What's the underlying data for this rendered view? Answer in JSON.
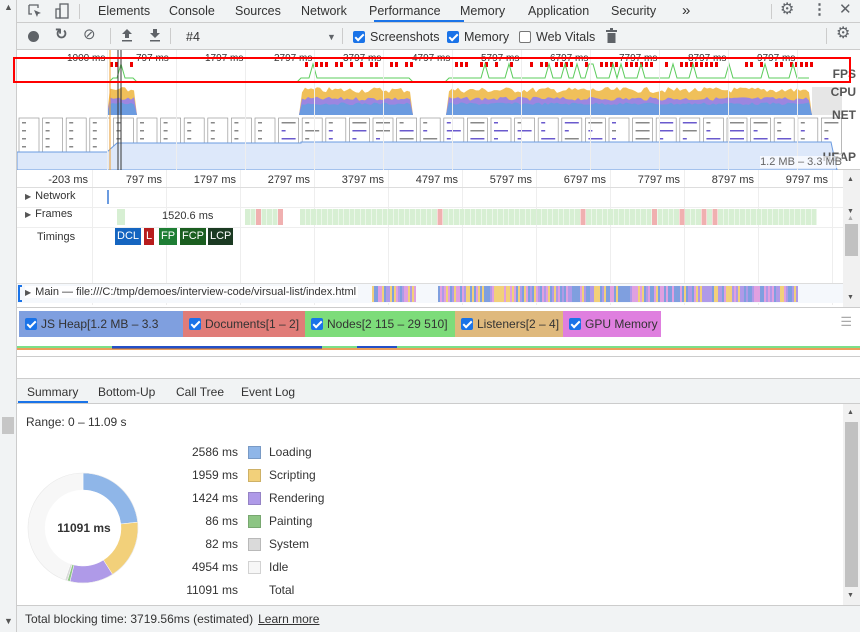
{
  "tabs": {
    "items": [
      {
        "label": "Elements"
      },
      {
        "label": "Console"
      },
      {
        "label": "Sources"
      },
      {
        "label": "Network"
      },
      {
        "label": "Performance",
        "active": true
      },
      {
        "label": "Memory"
      },
      {
        "label": "Application"
      },
      {
        "label": "Security"
      }
    ],
    "more": "»",
    "accent": "#1a73e8"
  },
  "toolbar": {
    "recording": "#4",
    "screenshots_label": "Screenshots",
    "screenshots_checked": true,
    "memory_label": "Memory",
    "memory_checked": true,
    "webvitals_label": "Web Vitals",
    "webvitals_checked": false
  },
  "overview": {
    "ticks": [
      "1000 ms",
      "797 ms",
      "1797 ms",
      "2797 ms",
      "3797 ms",
      "4797 ms",
      "5797 ms",
      "6797 ms",
      "7797 ms",
      "8797 ms",
      "9797 ms"
    ],
    "fps_label": "FPS",
    "cpu_label": "CPU",
    "net_label": "NET",
    "heap_label": "HEAP",
    "heap_range": "1.2 MB – 3.3 MB",
    "highlight_color": "#ff0000"
  },
  "timeline": {
    "ticks": [
      "-203 ms",
      "797 ms",
      "1797 ms",
      "2797 ms",
      "3797 ms",
      "4797 ms",
      "5797 ms",
      "6797 ms",
      "7797 ms",
      "8797 ms",
      "9797 ms"
    ],
    "network_label": "Network",
    "frames_label": "Frames",
    "frame_duration": "1520.6 ms",
    "timings_label": "Timings",
    "timings": [
      {
        "label": "DCL",
        "color": "#1565c0"
      },
      {
        "label": "L",
        "color": "#b71c1c"
      },
      {
        "label": "FP",
        "color": "#1e7e34"
      },
      {
        "label": "FCP",
        "color": "#1b5e20"
      },
      {
        "label": "LCP",
        "color": "#1b3a22"
      }
    ],
    "main_label": "Main — file:///C:/tmp/demoes/interview-code/virsual-list/index.html"
  },
  "counters": [
    {
      "label": "JS Heap[1.2 MB – 3.3 MB]",
      "color": "#7f9fdf",
      "checked": true
    },
    {
      "label": "Documents[1 – 2]",
      "color": "#e07c78",
      "checked": true
    },
    {
      "label": "Nodes[2 115 – 29 510]",
      "color": "#7ddc7a",
      "checked": true
    },
    {
      "label": "Listeners[2 – 4]",
      "color": "#dfb97d",
      "checked": true
    },
    {
      "label": "GPU Memory",
      "color": "#df7fdf",
      "checked": true
    }
  ],
  "bottom_tabs": [
    {
      "label": "Summary",
      "active": true
    },
    {
      "label": "Bottom-Up"
    },
    {
      "label": "Call Tree"
    },
    {
      "label": "Event Log"
    }
  ],
  "summary": {
    "range": "Range: 0 – 11.09 s",
    "total_center": "11091 ms",
    "items": [
      {
        "value": "2586 ms",
        "ms": 2586,
        "label": "Loading",
        "color": "#8fb6e8"
      },
      {
        "value": "1959 ms",
        "ms": 1959,
        "label": "Scripting",
        "color": "#f2d07a"
      },
      {
        "value": "1424 ms",
        "ms": 1424,
        "label": "Rendering",
        "color": "#af9ae8"
      },
      {
        "value": "86 ms",
        "ms": 86,
        "label": "Painting",
        "color": "#8dc584"
      },
      {
        "value": "82 ms",
        "ms": 82,
        "label": "System",
        "color": "#dadada"
      },
      {
        "value": "4954 ms",
        "ms": 4954,
        "label": "Idle",
        "color": "#f7f7f7"
      }
    ],
    "total_value": "11091 ms",
    "total_label": "Total"
  },
  "footer": {
    "text": "Total blocking time: 3719.56ms (estimated)",
    "link": "Learn more"
  }
}
